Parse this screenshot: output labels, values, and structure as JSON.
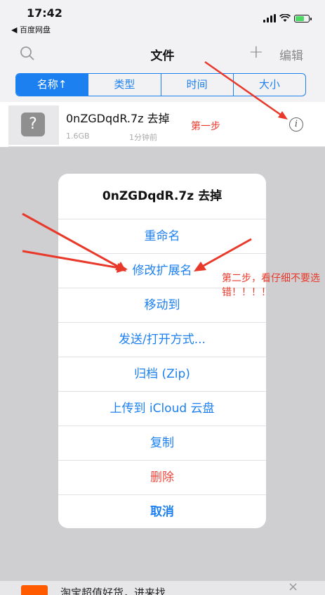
{
  "status_bar": {
    "time": "17:42",
    "back_app": "◀ 百度网盘"
  },
  "nav": {
    "title": "文件",
    "add_icon": "plus-icon",
    "search_icon": "search-icon",
    "edit_label": "编辑"
  },
  "sort_tabs": [
    "名称↑",
    "类型",
    "时间",
    "大小"
  ],
  "sort_active_index": 0,
  "file": {
    "name": "0nZGDqdR.7z 去掉",
    "size": "1.6GB",
    "time": "1分钟前",
    "info_label": "i",
    "icon_glyph": "?"
  },
  "action_sheet": {
    "title": "0nZGDqdR.7z 去掉",
    "items": [
      "重命名",
      "修改扩展名",
      "移动到",
      "发送/打开方式...",
      "归档 (Zip)",
      "上传到 iCloud 云盘",
      "复制",
      "删除"
    ],
    "cancel": "取消"
  },
  "annotations": {
    "step1": "第一步",
    "step2": "第二步，看仔细不要选错！！！！"
  },
  "ad": {
    "text": "淘宝超值好货，进来找",
    "close": "×"
  },
  "colors": {
    "accent": "#1d80f0",
    "destructive": "#f0463c",
    "annotation": "#e8392a"
  }
}
